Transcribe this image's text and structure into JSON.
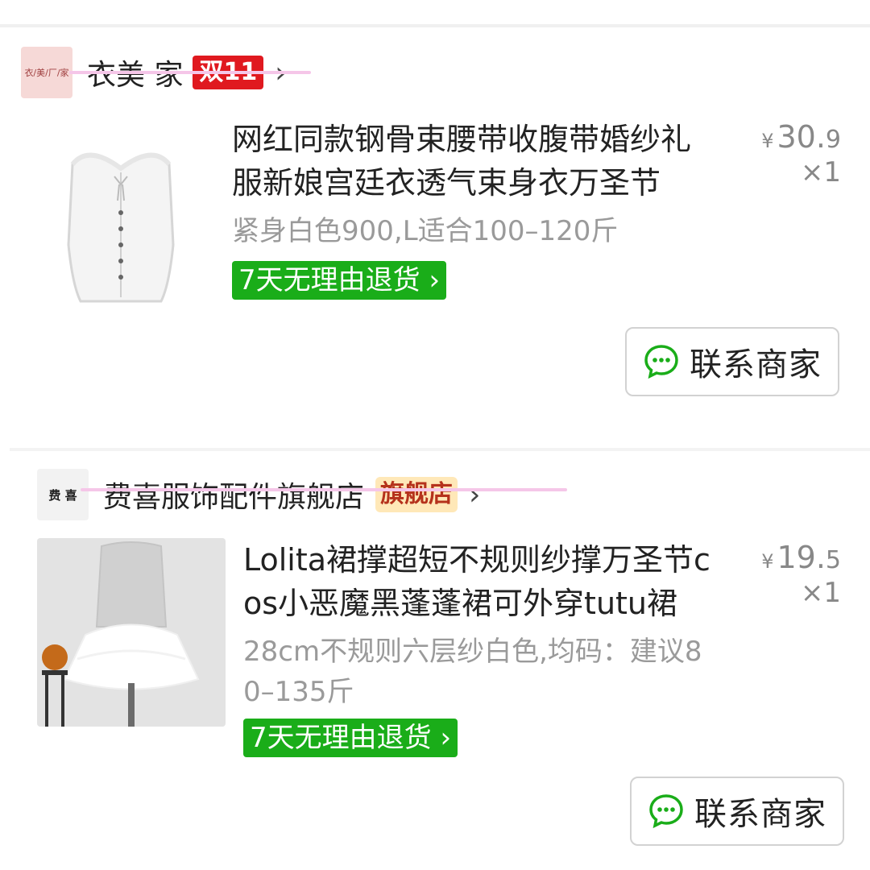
{
  "orders": [
    {
      "shop": {
        "name": "衣美  家",
        "logo_text": "衣/美/厂/家",
        "badge": "双11"
      },
      "item": {
        "title_line1": "网红同款钢骨束腰带收腹带婚纱礼",
        "title_line2": "服新娘宫廷衣透气束身衣万圣节",
        "spec": "紧身白色900,L适合100–120斤",
        "tag": "7天无理由退货",
        "currency": "¥",
        "price_int": "30.",
        "price_dec": "9",
        "qty": "×1"
      },
      "contact_label": "联系商家"
    },
    {
      "shop": {
        "name": "费喜服饰配件旗舰店",
        "logo_text": "费 喜",
        "badge": "旗舰店"
      },
      "item": {
        "title_line1": "Lolita裙撑超短不规则纱撑万圣节c",
        "title_line2": "os小恶魔黑蓬蓬裙可外穿tutu裙",
        "spec_line1": "28cm不规则六层纱白色,均码：建议8",
        "spec_line2": "0–135斤",
        "tag": "7天无理由退货",
        "currency": "¥",
        "price_int": "19.",
        "price_dec": "5",
        "qty": "×1"
      },
      "contact_label": "联系商家"
    }
  ],
  "colors": {
    "green_tag": "#1aad19",
    "double11_red": "#e0191f",
    "flagship_bg": "#ffe8b8",
    "chat_icon_green": "#1aad19"
  }
}
